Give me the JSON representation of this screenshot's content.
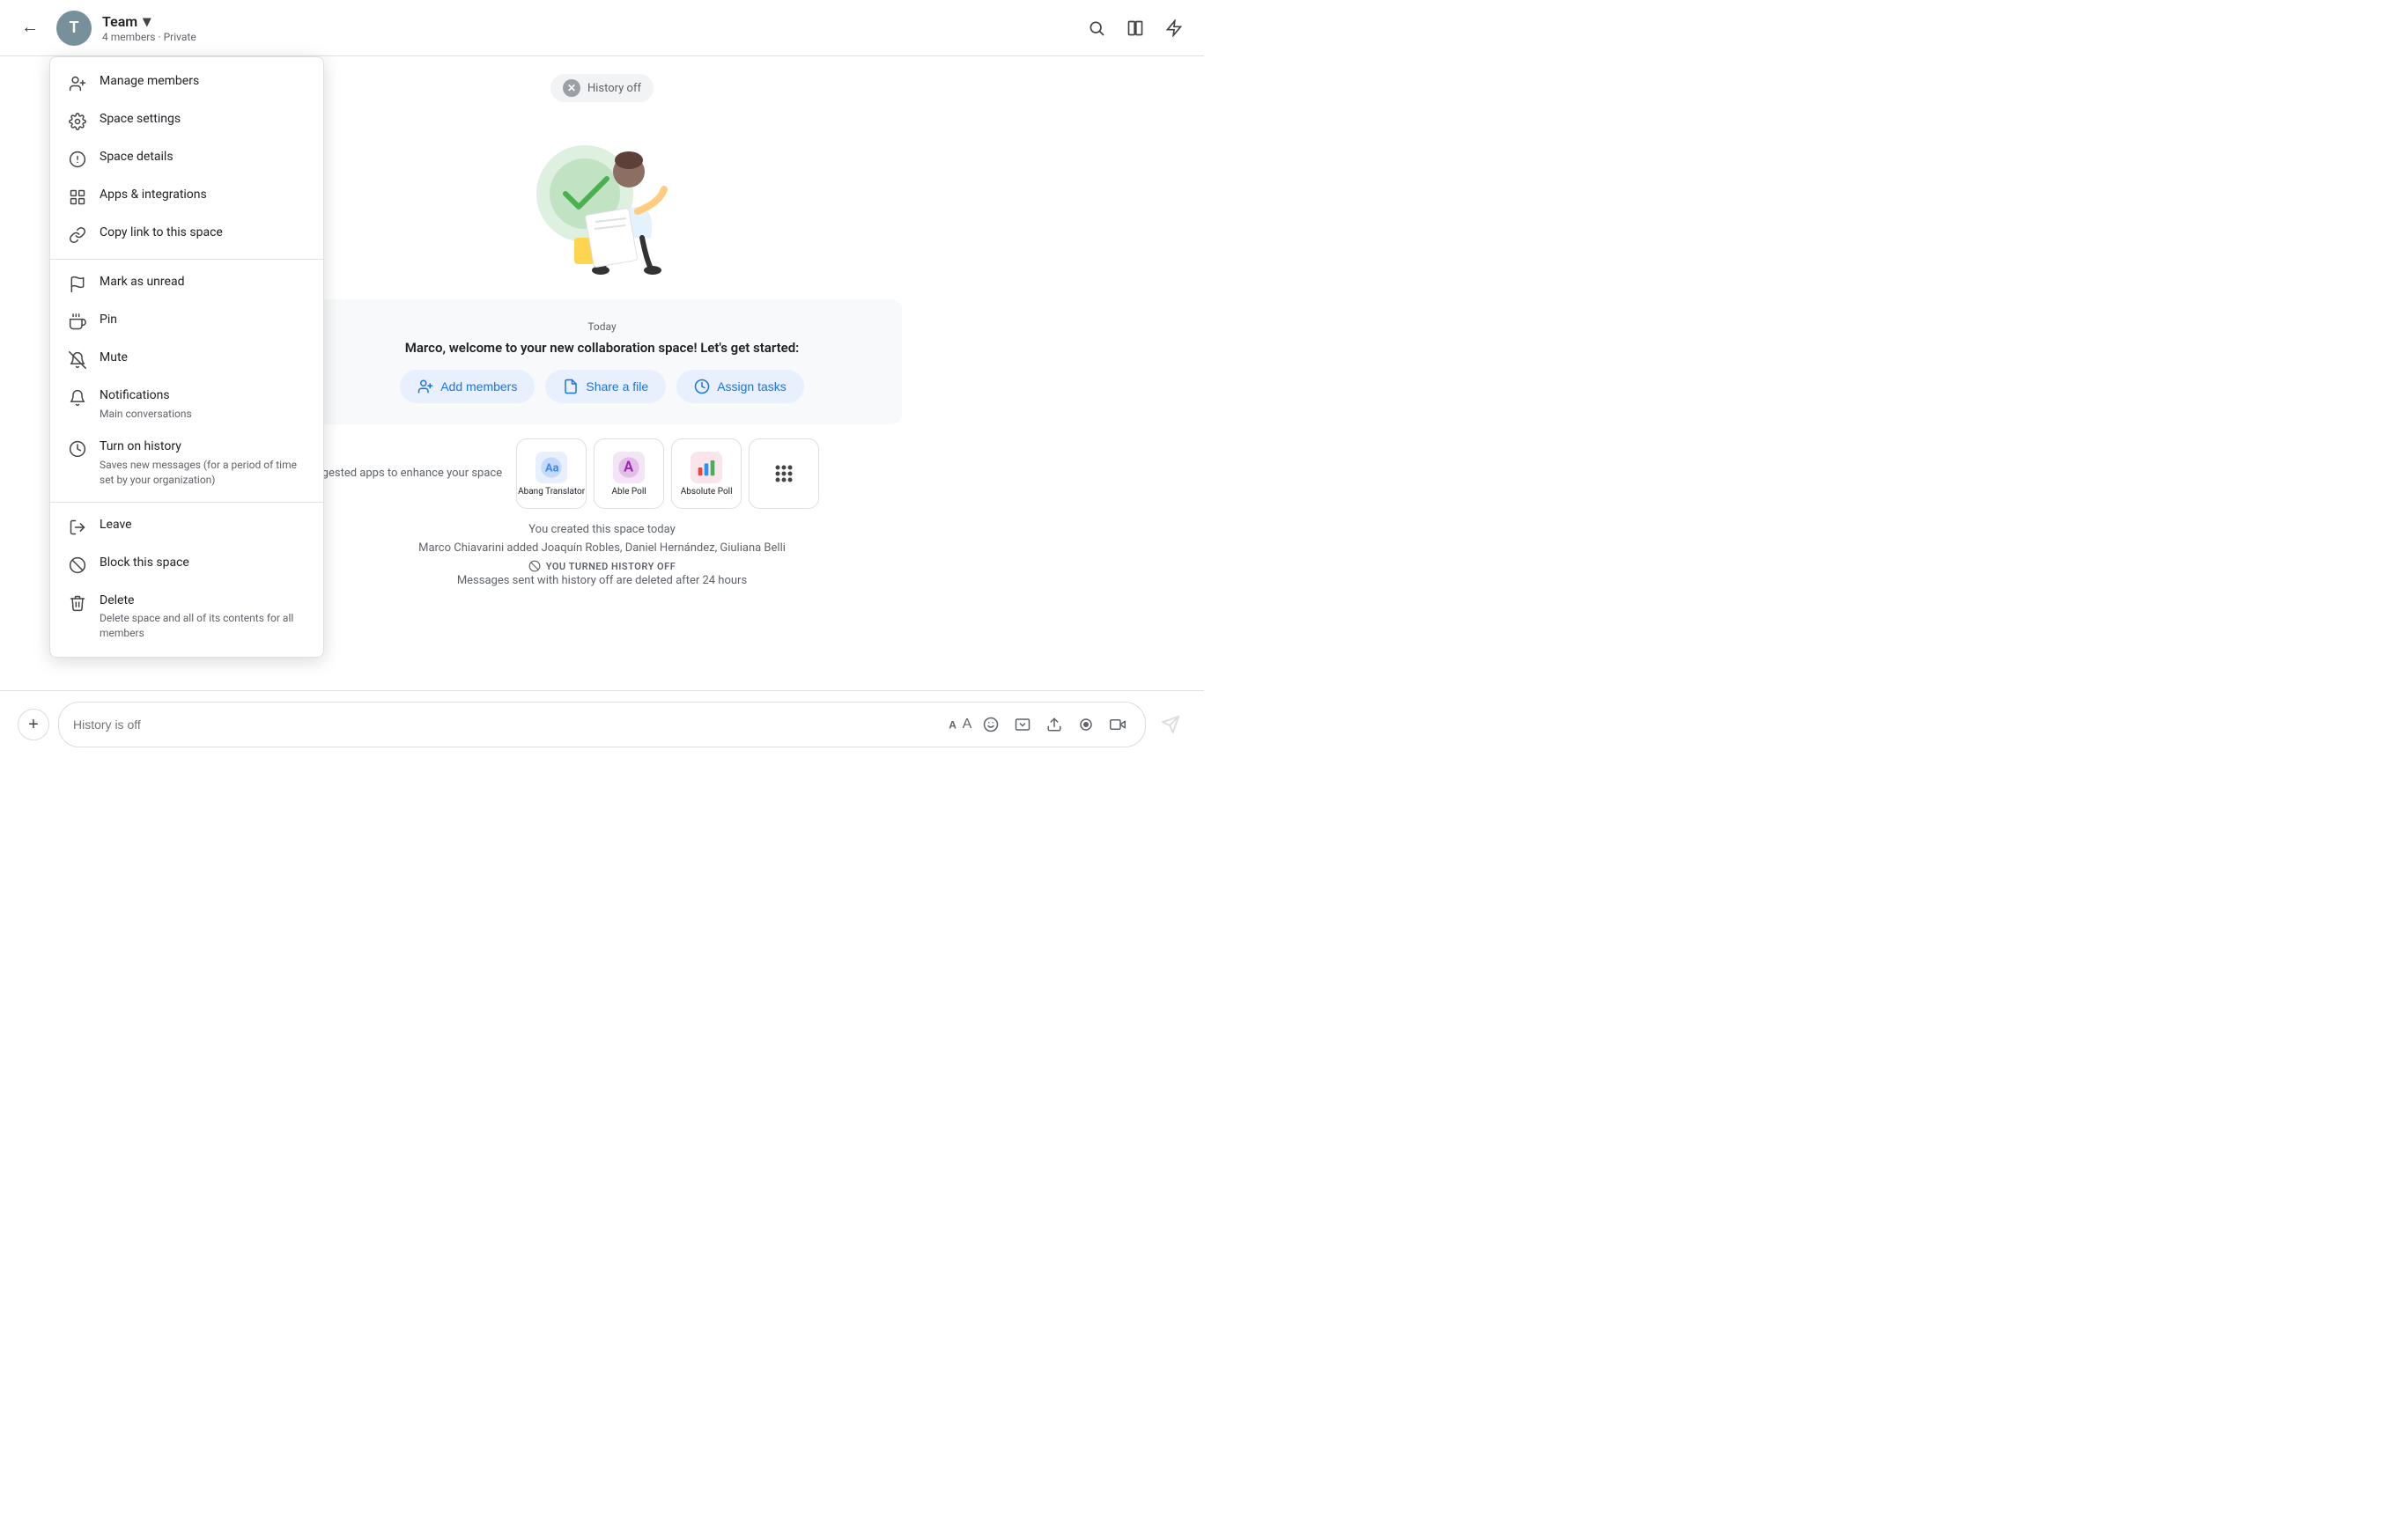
{
  "header": {
    "back_label": "←",
    "avatar_letter": "T",
    "space_name": "Team",
    "chevron": "▾",
    "meta": "4 members · Private",
    "search_label": "search",
    "split_label": "split",
    "more_label": "more"
  },
  "context_menu": {
    "items": [
      {
        "id": "manage-members",
        "icon": "👤+",
        "label": "Manage members",
        "sublabel": ""
      },
      {
        "id": "space-settings",
        "icon": "⚙",
        "label": "Space settings",
        "sublabel": ""
      },
      {
        "id": "space-details",
        "icon": "ℹ",
        "label": "Space details",
        "sublabel": ""
      },
      {
        "id": "apps-integrations",
        "icon": "⊞",
        "label": "Apps & integrations",
        "sublabel": ""
      },
      {
        "id": "copy-link",
        "icon": "🔗",
        "label": "Copy link to this space",
        "sublabel": ""
      },
      {
        "id": "mark-unread",
        "icon": "⚑",
        "label": "Mark as unread",
        "sublabel": ""
      },
      {
        "id": "pin",
        "icon": "🔔",
        "label": "Pin",
        "sublabel": ""
      },
      {
        "id": "mute",
        "icon": "🔕",
        "label": "Mute",
        "sublabel": ""
      },
      {
        "id": "notifications",
        "icon": "🔔",
        "label": "Notifications",
        "sublabel": "Main conversations"
      },
      {
        "id": "turn-on-history",
        "icon": "⏱",
        "label": "Turn on history",
        "sublabel": "Saves new messages (for a period of time set by your organization)"
      },
      {
        "id": "leave",
        "icon": "↪",
        "label": "Leave",
        "sublabel": ""
      },
      {
        "id": "block-space",
        "icon": "⊘",
        "label": "Block this space",
        "sublabel": ""
      },
      {
        "id": "delete",
        "icon": "🗑",
        "label": "Delete",
        "sublabel": "Delete space and all of its contents for all members"
      }
    ]
  },
  "chat": {
    "history_off": "History off",
    "today_label": "Today",
    "welcome_text": "Marco, welcome to your new collaboration space! Let's get started:",
    "btn_add_members": "Add members",
    "btn_share_file": "Share a file",
    "btn_assign_tasks": "Assign tasks",
    "suggested_label": "Suggested apps to enhance your space",
    "apps": [
      {
        "name": "Abang Translator",
        "color": "#4285f4"
      },
      {
        "name": "Able Poll",
        "color": "#9c27b0"
      },
      {
        "name": "Absolute Poll",
        "color": "#f44336"
      }
    ],
    "activity1": "You created this space today",
    "activity2": "Marco Chiavarini added Joaquín Robles, Daniel Hernández, Giuliana Belli",
    "history_off_label": "YOU TURNED HISTORY OFF",
    "history_off_sub": "Messages sent with history off are deleted after 24 hours"
  },
  "input_bar": {
    "placeholder": "History is off",
    "add_label": "+",
    "send_label": "➤"
  }
}
